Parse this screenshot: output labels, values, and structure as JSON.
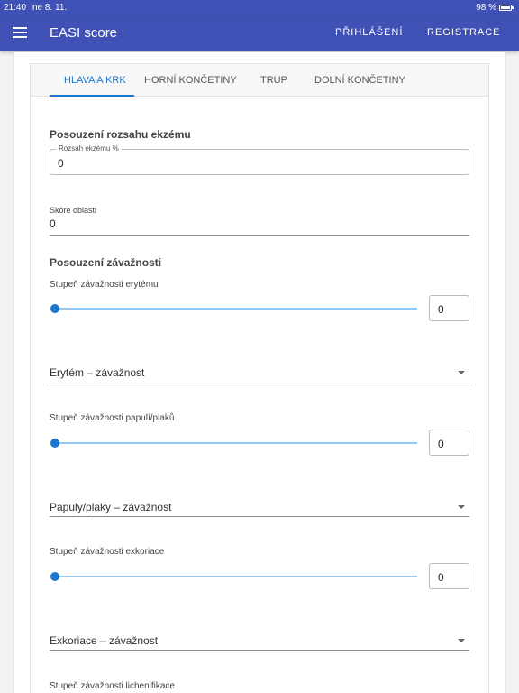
{
  "status": {
    "time": "21:40",
    "date": "ne 8. 11.",
    "battery": "98 %"
  },
  "appbar": {
    "title": "EASI score",
    "login": "PŘIHLÁŠENÍ",
    "register": "REGISTRACE"
  },
  "tabs": [
    {
      "label": "HLAVA A KRK",
      "active": true
    },
    {
      "label": "HORNÍ KONČETINY",
      "active": false
    },
    {
      "label": "TRUP",
      "active": false
    },
    {
      "label": "DOLNÍ KONČETINY",
      "active": false
    }
  ],
  "extent": {
    "title": "Posouzení rozsahu ekzému",
    "field_label": "Rozsah ekzému %",
    "field_value": "0",
    "score_label": "Skóre oblasti",
    "score_value": "0"
  },
  "severity": {
    "title": "Posouzení závažnosti",
    "items": [
      {
        "slider_label": "Stupeň závažnosti erytému",
        "value": "0",
        "select_label": "Erytém – závažnost"
      },
      {
        "slider_label": "Stupeň závažnosti papulí/plaků",
        "value": "0",
        "select_label": "Papuly/plaky – závažnost"
      },
      {
        "slider_label": "Stupeň závažnosti exkoriace",
        "value": "0",
        "select_label": "Exkoriace – závažnost"
      },
      {
        "slider_label": "Stupeň závažnosti lichenifikace"
      }
    ]
  },
  "colors": {
    "primary": "#3f51b5",
    "accent": "#1976d2",
    "track": "#90caf9"
  }
}
